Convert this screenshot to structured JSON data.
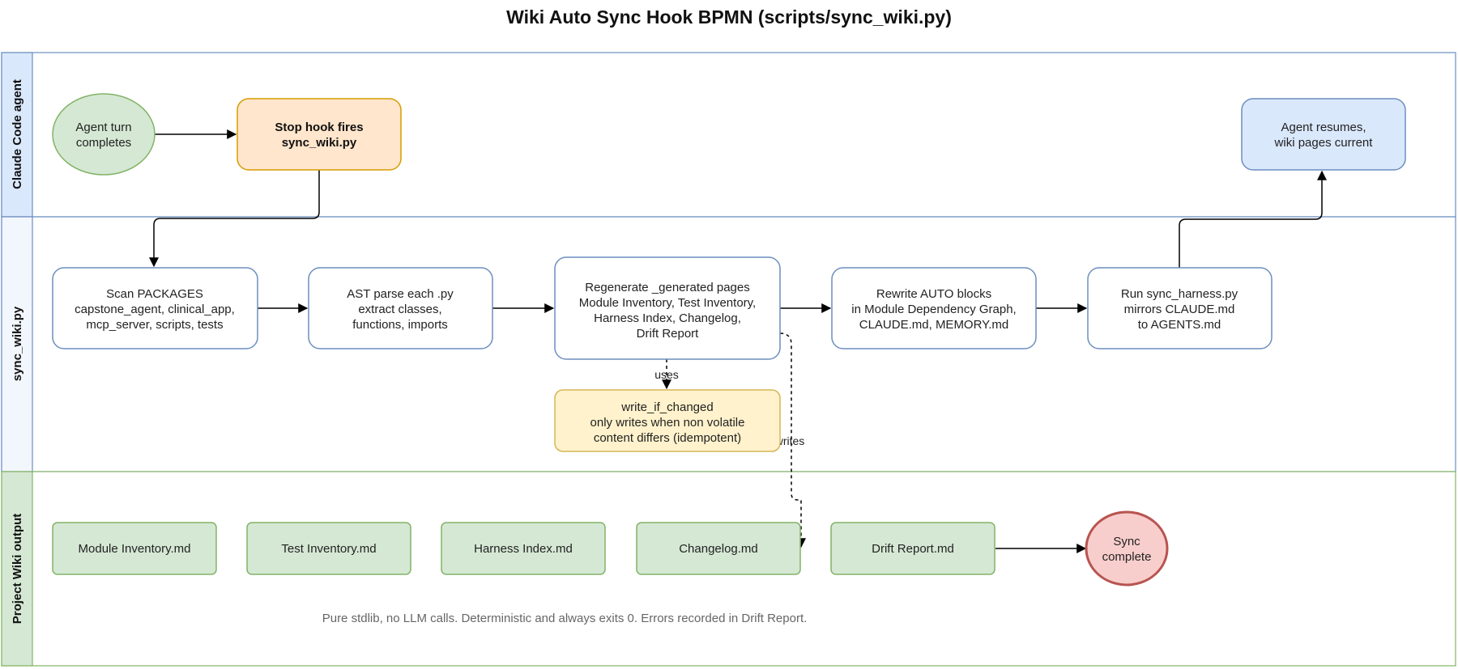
{
  "title": "Wiki Auto Sync Hook BPMN (scripts/sync_wiki.py)",
  "colors": {
    "lane_border_blue": "#6c8ebf",
    "lane_header_blue": "#dae8fc",
    "lane_header_light": "#f2f6fd",
    "lane_border_green": "#82b366",
    "lane_header_green": "#d5e8d4",
    "green_fill": "#d5e8d4",
    "green_stroke": "#82b366",
    "orange_fill": "#ffe6cc",
    "orange_stroke": "#d79b00",
    "blue_fill": "#dae8fc",
    "blue_stroke": "#6c8ebf",
    "yellow_fill": "#fff2cc",
    "yellow_stroke": "#d6b656",
    "red_fill": "#f8cecc",
    "red_stroke": "#b85450",
    "white_fill": "#ffffff",
    "edge": "#000000"
  },
  "lanes": [
    {
      "id": "claude",
      "label": "Claude Code agent"
    },
    {
      "id": "sync",
      "label": "sync_wiki.py"
    },
    {
      "id": "wiki",
      "label": "Project Wiki output"
    }
  ],
  "nodes": {
    "agent_turn": {
      "lines": [
        "Agent turn",
        "completes"
      ]
    },
    "stop_hook": {
      "lines": [
        "Stop hook fires",
        "sync_wiki.py"
      ]
    },
    "agent_resumes": {
      "lines": [
        "Agent resumes,",
        "wiki pages current"
      ]
    },
    "scan": {
      "lines": [
        "Scan PACKAGES",
        "capstone_agent, clinical_app,",
        "mcp_server, scripts, tests"
      ]
    },
    "ast": {
      "lines": [
        "AST parse each .py",
        "extract classes,",
        "functions, imports"
      ]
    },
    "regen": {
      "lines": [
        "Regenerate _generated pages",
        "Module Inventory, Test Inventory,",
        "Harness Index, Changelog,",
        "Drift Report"
      ]
    },
    "rewrite": {
      "lines": [
        "Rewrite AUTO blocks",
        "in Module Dependency Graph,",
        "CLAUDE.md, MEMORY.md"
      ]
    },
    "harness": {
      "lines": [
        "Run sync_harness.py",
        "mirrors CLAUDE.md",
        "to AGENTS.md"
      ]
    },
    "write_if_changed": {
      "lines": [
        "write_if_changed",
        "only writes when non volatile",
        "content differs (idempotent)"
      ]
    },
    "module_inv": {
      "lines": [
        "Module Inventory.md"
      ]
    },
    "test_inv": {
      "lines": [
        "Test Inventory.md"
      ]
    },
    "harness_idx": {
      "lines": [
        "Harness Index.md"
      ]
    },
    "changelog": {
      "lines": [
        "Changelog.md"
      ]
    },
    "drift": {
      "lines": [
        "Drift Report.md"
      ]
    },
    "sync_complete": {
      "lines": [
        "Sync",
        "complete"
      ]
    }
  },
  "edge_labels": {
    "uses": "uses",
    "writes": "writes"
  },
  "footnote": "Pure stdlib, no LLM calls. Deterministic and always exits 0. Errors recorded in Drift Report."
}
